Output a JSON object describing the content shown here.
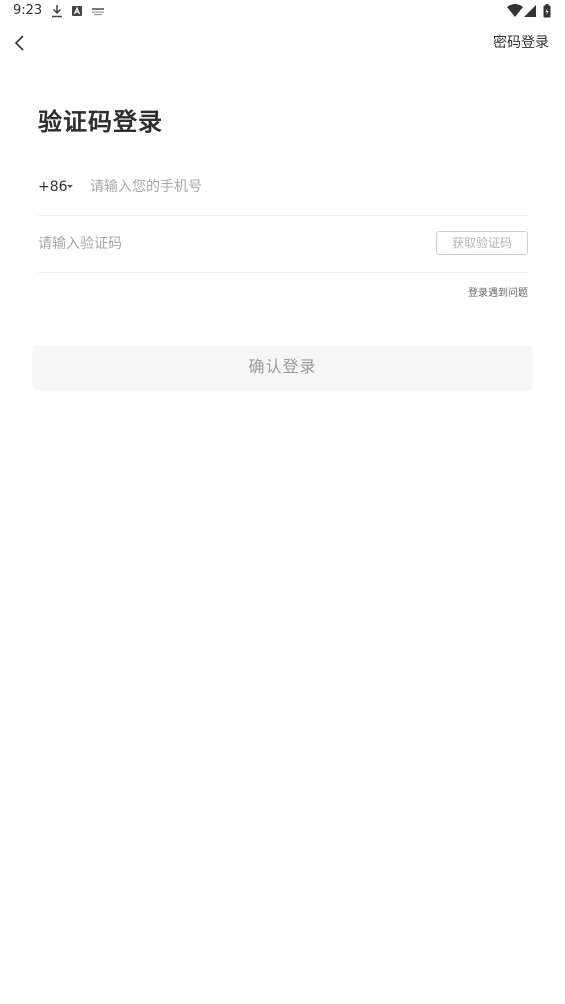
{
  "status_bar": {
    "time": "9:23",
    "icons": [
      "download-icon",
      "app-a-icon",
      "notification-icon",
      "wifi-icon",
      "signal-icon",
      "battery-icon"
    ]
  },
  "nav": {
    "back_icon": "chevron-left-icon",
    "password_login_label": "密码登录"
  },
  "title": "验证码登录",
  "phone": {
    "country_code": "+86",
    "placeholder": "请输入您的手机号",
    "value": ""
  },
  "verification": {
    "placeholder": "请输入验证码",
    "value": "",
    "get_code_label": "获取验证码"
  },
  "login_problem_label": "登录遇到问题",
  "confirm_label": "确认登录",
  "colors": {
    "background": "#ffffff",
    "text": "#333333",
    "placeholder": "#a8a8a8",
    "button_bg": "#f6f6f6",
    "button_text": "#9a9a9a"
  }
}
